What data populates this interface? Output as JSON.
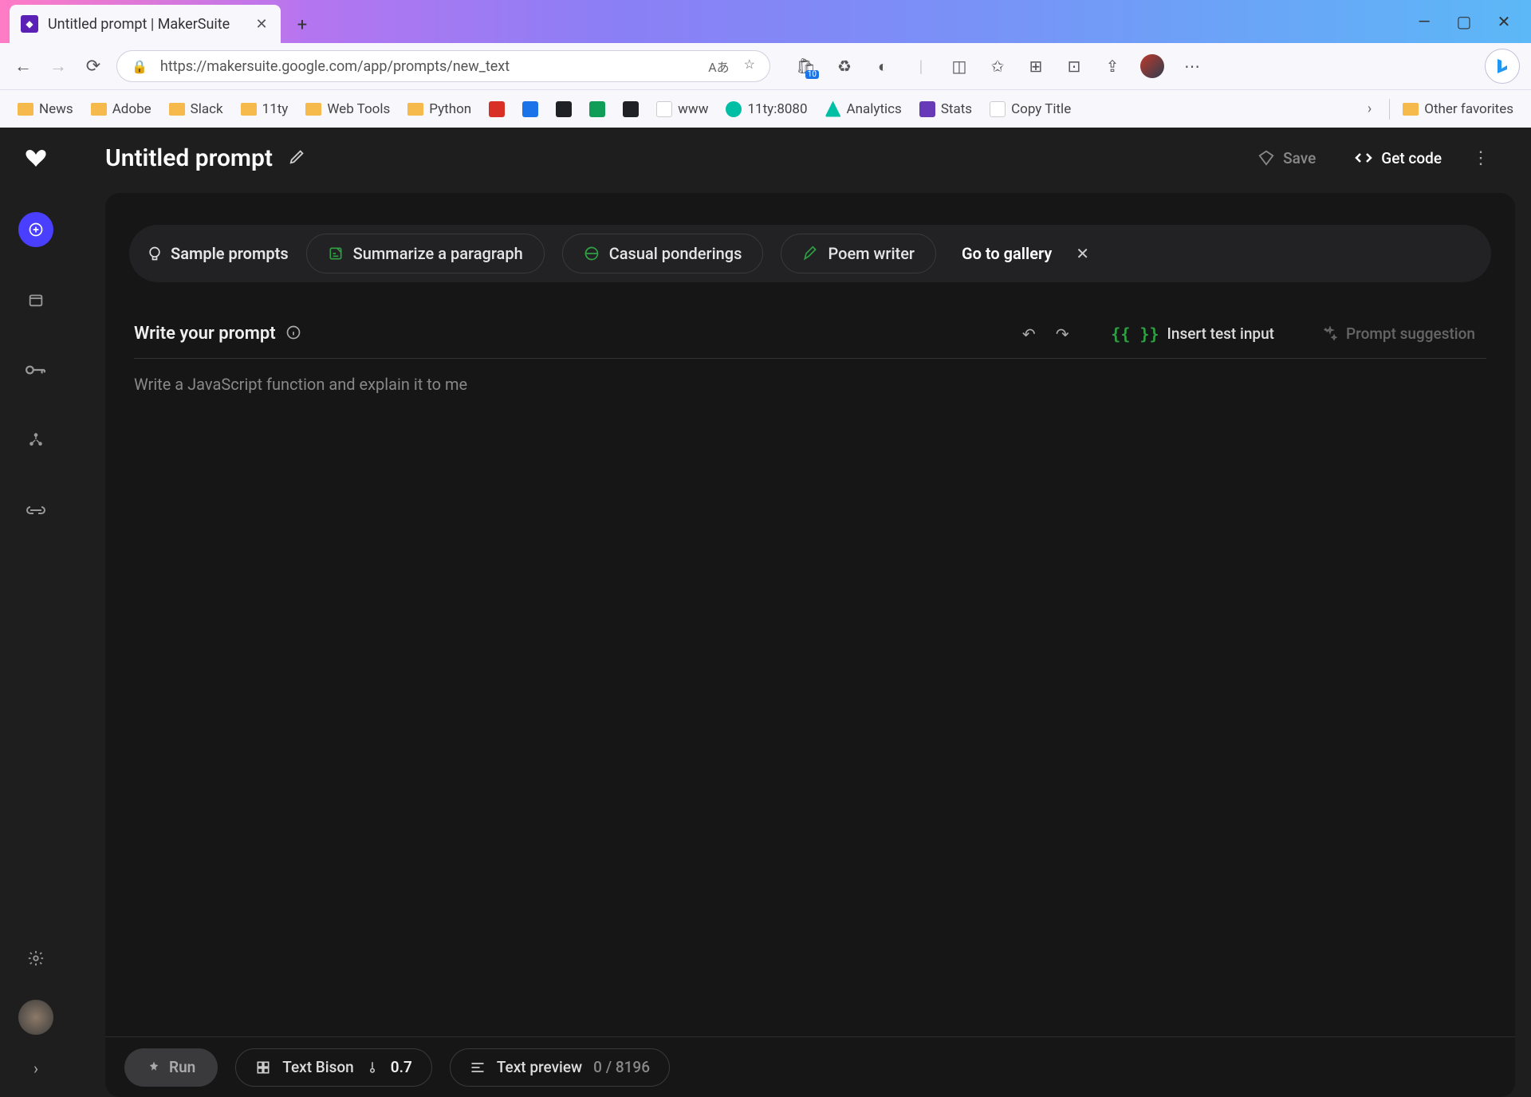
{
  "browser": {
    "tab_title": "Untitled prompt | MakerSuite",
    "url": "https://makersuite.google.com/app/prompts/new_text",
    "bookmarks": [
      "News",
      "Adobe",
      "Slack",
      "11ty",
      "Web Tools",
      "Python"
    ],
    "bookmark_icons_after": [
      "www",
      "11ty:8080",
      "Analytics",
      "Stats",
      "Copy Title"
    ],
    "other_favorites": "Other favorites"
  },
  "header": {
    "title": "Untitled prompt",
    "save": "Save",
    "get_code": "Get code"
  },
  "chips": {
    "label": "Sample prompts",
    "items": [
      "Summarize a paragraph",
      "Casual ponderings",
      "Poem writer"
    ],
    "gallery": "Go to gallery"
  },
  "prompt": {
    "heading": "Write your prompt",
    "insert_test": "Insert test input",
    "suggestion": "Prompt suggestion",
    "text": "Write a JavaScript function and explain it to me"
  },
  "footer": {
    "run": "Run",
    "model": "Text Bison",
    "temperature": "0.7",
    "preview_label": "Text preview",
    "token_count": "0 / 8196"
  }
}
